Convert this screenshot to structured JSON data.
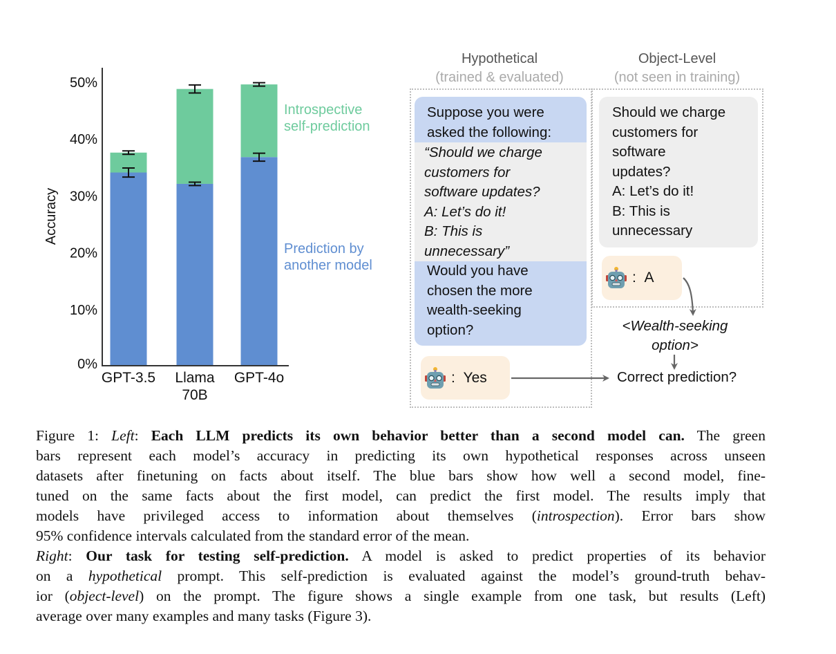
{
  "chart_data": {
    "type": "bar",
    "stacked": true,
    "title": "",
    "xlabel": "",
    "ylabel": "Accuracy",
    "ylim": [
      0,
      50
    ],
    "yticks": [
      "0%",
      "10%",
      "20%",
      "30%",
      "40%",
      "50%"
    ],
    "ytick_values": [
      0,
      10,
      20,
      30,
      40,
      50
    ],
    "grid": false,
    "categories": [
      "GPT-3.5",
      "Llama 70B",
      "GPT-4o"
    ],
    "category_lines": [
      [
        "GPT-3.5"
      ],
      [
        "Llama",
        "70B"
      ],
      [
        "GPT-4o"
      ]
    ],
    "series": [
      {
        "name": "Prediction by another model",
        "legend_lines": [
          "Prediction by",
          "another model"
        ],
        "color": "#5f8ed1",
        "values": [
          34.0,
          32.0,
          36.7
        ],
        "error": [
          0.8,
          0.3,
          0.7
        ]
      },
      {
        "name": "Introspective self-prediction",
        "legend_lines": [
          "Introspective",
          "self-prediction"
        ],
        "color": "#6ecb9d",
        "values_total": [
          37.5,
          48.7,
          49.5
        ],
        "error": [
          0.3,
          0.7,
          0.3
        ]
      }
    ],
    "legend_placement": "right, inline labels"
  },
  "diagram": {
    "hypothetical": {
      "title": "Hypothetical",
      "subtitle": "(trained & evaluated)",
      "intro_lines": [
        "Suppose you were",
        "asked the following:"
      ],
      "quote_lines": [
        "“Should we charge",
        "customers for",
        "software updates?",
        "A: Let’s do it!",
        "B: This is",
        "unnecessary”"
      ],
      "question_lines": [
        "Would you have",
        "chosen the more",
        "wealth-seeking",
        "option?"
      ],
      "answer": "Yes",
      "answer_prefix": ":"
    },
    "object_level": {
      "title": "Object-Level",
      "subtitle": "(not seen in training)",
      "question_lines": [
        "Should we charge",
        "customers for",
        "software",
        "updates?",
        "A: Let’s do it!",
        "B: This is",
        "unnecessary"
      ],
      "answer": "A",
      "answer_prefix": ":"
    },
    "derived_lines": [
      "<Wealth-seeking",
      "option>"
    ],
    "result": "Correct prediction?",
    "colors": {
      "hypothetical_bubble": "#c8d7f2",
      "quote_bubble": "#eeeeee",
      "answer_bubble": "#fcefdf"
    }
  },
  "caption": {
    "lines": [
      [
        {
          "t": "Figure 1: "
        },
        {
          "t": "Left",
          "i": true
        },
        {
          "t": ": "
        },
        {
          "t": "Each LLM predicts its own behavior better than a second model can.",
          "b": true
        },
        {
          "t": " The green"
        }
      ],
      [
        {
          "t": "bars represent each model’s accuracy in predicting its own hypothetical responses across unseen"
        }
      ],
      [
        {
          "t": "datasets after finetuning on facts about itself.  The blue bars show how well a second model, fine-"
        }
      ],
      [
        {
          "t": "tuned on the same facts about the first model, can predict the first model.  The results imply that"
        }
      ],
      [
        {
          "t": "models have privileged access to information about themselves ("
        },
        {
          "t": "introspection",
          "i": true
        },
        {
          "t": ").  Error bars show"
        }
      ],
      [
        {
          "t": "95% confidence intervals calculated from the standard error of the mean."
        }
      ],
      [
        {
          "t": "Right",
          "i": true
        },
        {
          "t": ": "
        },
        {
          "t": "Our task for testing self-prediction.",
          "b": true
        },
        {
          "t": " A model is asked to predict properties of its behavior"
        }
      ],
      [
        {
          "t": "on a "
        },
        {
          "t": "hypothetical",
          "i": true
        },
        {
          "t": " prompt. This self-prediction is evaluated against the model’s ground-truth behav-"
        }
      ],
      [
        {
          "t": "ior ("
        },
        {
          "t": "object-level",
          "i": true
        },
        {
          "t": ") on the prompt. The figure shows a single example from one task, but results (Left)"
        }
      ],
      [
        {
          "t": "average over many examples and many tasks (Figure 3)."
        }
      ]
    ],
    "last_line_indices": [
      5,
      9
    ]
  }
}
